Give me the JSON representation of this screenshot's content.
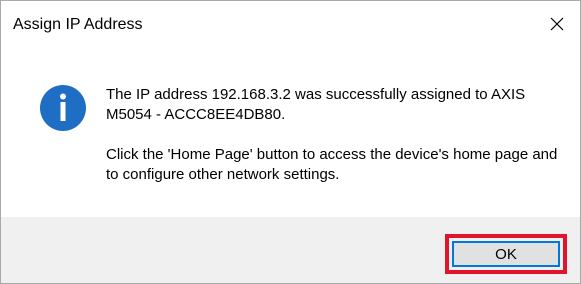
{
  "dialog": {
    "title": "Assign IP Address",
    "close_glyph": "✕",
    "message_line1": "The IP address 192.168.3.2 was successfully assigned to AXIS M5054 - ACCC8EE4DB80.",
    "message_line2": "Click the 'Home Page' button to access the device's home page and to configure other network settings.",
    "ok_label": "OK",
    "icon": "info-icon"
  },
  "colors": {
    "info_icon_bg": "#1e6fc4",
    "highlight_border": "#e0142a",
    "button_focus_border": "#0078d7",
    "footer_bg": "#f0f0f0"
  }
}
